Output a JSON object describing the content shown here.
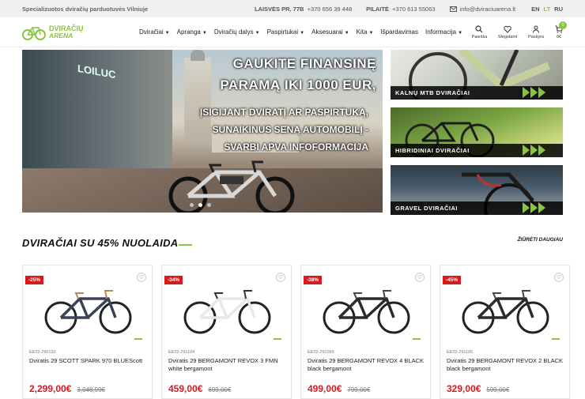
{
  "topbar": {
    "tagline": "Specializuotos dviračių parduotuvės Vilniuje",
    "store1_addr": "LAISVĖS PR. 77B",
    "store1_phone": "+370 656 39 448",
    "store2_addr": "PILAITĖ",
    "store2_phone": "+370 613 55063",
    "email": "info@dviraciuarena.lt",
    "langs": [
      "EN",
      "LT",
      "RU"
    ],
    "active_lang": "LT"
  },
  "logo": {
    "line1": "DVIRAČIŲ",
    "line2": "ARENA"
  },
  "nav": [
    {
      "label": "Dviračiai",
      "caret": true
    },
    {
      "label": "Apranga",
      "caret": true
    },
    {
      "label": "Dviračių dalys",
      "caret": true
    },
    {
      "label": "Paspirtukai",
      "caret": true
    },
    {
      "label": "Aksesuarai",
      "caret": true
    },
    {
      "label": "Kita",
      "caret": true
    },
    {
      "label": "Išpardavimas",
      "caret": false
    },
    {
      "label": "Informacija",
      "caret": true
    }
  ],
  "header_icons": {
    "search": "Paieška",
    "favorites": "Mėgstami",
    "account": "Paskyra",
    "cart_count": "0",
    "cart_total": "0€"
  },
  "hero": {
    "headline": "GAUKITE FINANSINĘ PARAMĄ IKI 1000 EUR,",
    "sub": "ĮSIGIJANT DVIRATĮ AR PASPIRTUKĄ, SUNAIKINUS SENĄ AUTOMOBILĮ - SVARBI APVA INFOFORMACIJA",
    "shop_sign": "LOILUC",
    "slides": 3,
    "active_slide": 2
  },
  "categories": [
    {
      "label": "KALNŲ MTB DVIRAČIAI"
    },
    {
      "label": "HIBRIDINIAI DVIRAČIAI"
    },
    {
      "label": "GRAVEL DVIRAČIAI"
    }
  ],
  "section": {
    "title": "DVIRAČIAI SU 45% NUOLAIDA",
    "see_more": "ŽIŪRĖTI DAUGIAU"
  },
  "products": [
    {
      "discount": "-25%",
      "sku": "EE02-290132",
      "name": "Dviratis 29 SCOTT SPARK 970 BLUEScott",
      "price": "2,299,00€",
      "old_price": "3,048,99€",
      "frame_color": "#3a4256",
      "accent": "#b08a5a"
    },
    {
      "discount": "-34%",
      "sku": "EE02-291104",
      "name": "Dviratis 29 BERGAMONT REVOX 3 FMN white bergamont",
      "price": "459,00€",
      "old_price": "699,00€",
      "frame_color": "#e8e8e8",
      "accent": "#333333"
    },
    {
      "discount": "-38%",
      "sku": "EE02-291099",
      "name": "Dviratis 29 BERGAMONT REVOX 4 BLACK black bergamont",
      "price": "499,00€",
      "old_price": "799,00€",
      "frame_color": "#2b2b2b",
      "accent": "#444444"
    },
    {
      "discount": "-45%",
      "sku": "EE02-291105",
      "name": "Dviratis 29 BERGAMONT REVOX 2 BLACK black bergamont",
      "price": "329,00€",
      "old_price": "599,00€",
      "frame_color": "#2b2b2b",
      "accent": "#444444"
    }
  ],
  "colors": {
    "brand": "#8bc53f",
    "sale": "#d71920"
  }
}
